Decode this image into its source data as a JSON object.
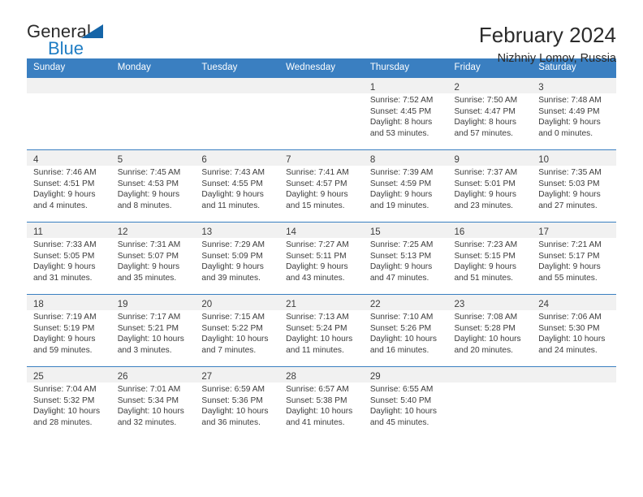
{
  "brand": {
    "name_top": "General",
    "name_bottom": "Blue",
    "triangle_color": "#1565a8",
    "blue_color": "#1f7dc4"
  },
  "header": {
    "title": "February 2024",
    "subtitle": "Nizhniy Lomov, Russia"
  },
  "theme": {
    "header_bg": "#3a7fc1",
    "daynum_bg": "#f1f1f1",
    "text": "#3c3c3c"
  },
  "calendar": {
    "weekday_headers": [
      "Sunday",
      "Monday",
      "Tuesday",
      "Wednesday",
      "Thursday",
      "Friday",
      "Saturday"
    ],
    "weeks": [
      [
        {
          "day": "",
          "lines": []
        },
        {
          "day": "",
          "lines": []
        },
        {
          "day": "",
          "lines": []
        },
        {
          "day": "",
          "lines": []
        },
        {
          "day": "1",
          "lines": [
            "Sunrise: 7:52 AM",
            "Sunset: 4:45 PM",
            "Daylight: 8 hours",
            "and 53 minutes."
          ]
        },
        {
          "day": "2",
          "lines": [
            "Sunrise: 7:50 AM",
            "Sunset: 4:47 PM",
            "Daylight: 8 hours",
            "and 57 minutes."
          ]
        },
        {
          "day": "3",
          "lines": [
            "Sunrise: 7:48 AM",
            "Sunset: 4:49 PM",
            "Daylight: 9 hours",
            "and 0 minutes."
          ]
        }
      ],
      [
        {
          "day": "4",
          "lines": [
            "Sunrise: 7:46 AM",
            "Sunset: 4:51 PM",
            "Daylight: 9 hours",
            "and 4 minutes."
          ]
        },
        {
          "day": "5",
          "lines": [
            "Sunrise: 7:45 AM",
            "Sunset: 4:53 PM",
            "Daylight: 9 hours",
            "and 8 minutes."
          ]
        },
        {
          "day": "6",
          "lines": [
            "Sunrise: 7:43 AM",
            "Sunset: 4:55 PM",
            "Daylight: 9 hours",
            "and 11 minutes."
          ]
        },
        {
          "day": "7",
          "lines": [
            "Sunrise: 7:41 AM",
            "Sunset: 4:57 PM",
            "Daylight: 9 hours",
            "and 15 minutes."
          ]
        },
        {
          "day": "8",
          "lines": [
            "Sunrise: 7:39 AM",
            "Sunset: 4:59 PM",
            "Daylight: 9 hours",
            "and 19 minutes."
          ]
        },
        {
          "day": "9",
          "lines": [
            "Sunrise: 7:37 AM",
            "Sunset: 5:01 PM",
            "Daylight: 9 hours",
            "and 23 minutes."
          ]
        },
        {
          "day": "10",
          "lines": [
            "Sunrise: 7:35 AM",
            "Sunset: 5:03 PM",
            "Daylight: 9 hours",
            "and 27 minutes."
          ]
        }
      ],
      [
        {
          "day": "11",
          "lines": [
            "Sunrise: 7:33 AM",
            "Sunset: 5:05 PM",
            "Daylight: 9 hours",
            "and 31 minutes."
          ]
        },
        {
          "day": "12",
          "lines": [
            "Sunrise: 7:31 AM",
            "Sunset: 5:07 PM",
            "Daylight: 9 hours",
            "and 35 minutes."
          ]
        },
        {
          "day": "13",
          "lines": [
            "Sunrise: 7:29 AM",
            "Sunset: 5:09 PM",
            "Daylight: 9 hours",
            "and 39 minutes."
          ]
        },
        {
          "day": "14",
          "lines": [
            "Sunrise: 7:27 AM",
            "Sunset: 5:11 PM",
            "Daylight: 9 hours",
            "and 43 minutes."
          ]
        },
        {
          "day": "15",
          "lines": [
            "Sunrise: 7:25 AM",
            "Sunset: 5:13 PM",
            "Daylight: 9 hours",
            "and 47 minutes."
          ]
        },
        {
          "day": "16",
          "lines": [
            "Sunrise: 7:23 AM",
            "Sunset: 5:15 PM",
            "Daylight: 9 hours",
            "and 51 minutes."
          ]
        },
        {
          "day": "17",
          "lines": [
            "Sunrise: 7:21 AM",
            "Sunset: 5:17 PM",
            "Daylight: 9 hours",
            "and 55 minutes."
          ]
        }
      ],
      [
        {
          "day": "18",
          "lines": [
            "Sunrise: 7:19 AM",
            "Sunset: 5:19 PM",
            "Daylight: 9 hours",
            "and 59 minutes."
          ]
        },
        {
          "day": "19",
          "lines": [
            "Sunrise: 7:17 AM",
            "Sunset: 5:21 PM",
            "Daylight: 10 hours",
            "and 3 minutes."
          ]
        },
        {
          "day": "20",
          "lines": [
            "Sunrise: 7:15 AM",
            "Sunset: 5:22 PM",
            "Daylight: 10 hours",
            "and 7 minutes."
          ]
        },
        {
          "day": "21",
          "lines": [
            "Sunrise: 7:13 AM",
            "Sunset: 5:24 PM",
            "Daylight: 10 hours",
            "and 11 minutes."
          ]
        },
        {
          "day": "22",
          "lines": [
            "Sunrise: 7:10 AM",
            "Sunset: 5:26 PM",
            "Daylight: 10 hours",
            "and 16 minutes."
          ]
        },
        {
          "day": "23",
          "lines": [
            "Sunrise: 7:08 AM",
            "Sunset: 5:28 PM",
            "Daylight: 10 hours",
            "and 20 minutes."
          ]
        },
        {
          "day": "24",
          "lines": [
            "Sunrise: 7:06 AM",
            "Sunset: 5:30 PM",
            "Daylight: 10 hours",
            "and 24 minutes."
          ]
        }
      ],
      [
        {
          "day": "25",
          "lines": [
            "Sunrise: 7:04 AM",
            "Sunset: 5:32 PM",
            "Daylight: 10 hours",
            "and 28 minutes."
          ]
        },
        {
          "day": "26",
          "lines": [
            "Sunrise: 7:01 AM",
            "Sunset: 5:34 PM",
            "Daylight: 10 hours",
            "and 32 minutes."
          ]
        },
        {
          "day": "27",
          "lines": [
            "Sunrise: 6:59 AM",
            "Sunset: 5:36 PM",
            "Daylight: 10 hours",
            "and 36 minutes."
          ]
        },
        {
          "day": "28",
          "lines": [
            "Sunrise: 6:57 AM",
            "Sunset: 5:38 PM",
            "Daylight: 10 hours",
            "and 41 minutes."
          ]
        },
        {
          "day": "29",
          "lines": [
            "Sunrise: 6:55 AM",
            "Sunset: 5:40 PM",
            "Daylight: 10 hours",
            "and 45 minutes."
          ]
        },
        {
          "day": "",
          "lines": []
        },
        {
          "day": "",
          "lines": []
        }
      ]
    ]
  }
}
